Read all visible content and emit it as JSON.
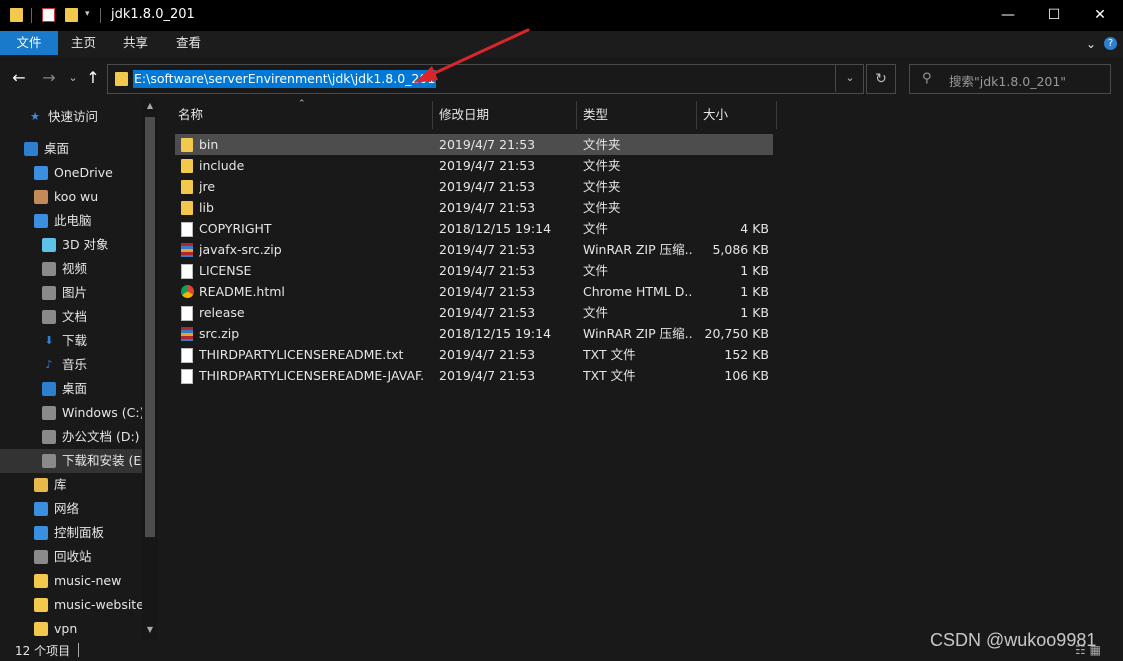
{
  "window": {
    "title": "jdk1.8.0_201",
    "minimize": "—",
    "maximize": "☐",
    "close": "✕"
  },
  "ribbon": {
    "tabs": [
      "文件",
      "主页",
      "共享",
      "查看"
    ],
    "collapse_icon": "chevron-down-icon",
    "help_icon": "question-icon"
  },
  "nav": {
    "back": "←",
    "forward": "→",
    "recent": "⌄",
    "up": "↑",
    "address": "E:\\software\\serverEnvirenment\\jdk\\jdk1.8.0_201",
    "dropdown": "⌄",
    "refresh": "↻",
    "search_placeholder": "搜索\"jdk1.8.0_201\""
  },
  "sidebar": {
    "items": [
      {
        "label": "快速访问",
        "icon": "star-icon",
        "color": "#3b8fe0"
      },
      {
        "label": "桌面",
        "icon": "desktop-icon",
        "color": "#2f7fd1"
      },
      {
        "label": "OneDrive",
        "icon": "cloud-icon",
        "color": "#3b8fe0"
      },
      {
        "label": "koo wu",
        "icon": "user-icon",
        "color": "#c48a5a"
      },
      {
        "label": "此电脑",
        "icon": "computer-icon",
        "color": "#3b8fe0"
      },
      {
        "label": "3D 对象",
        "icon": "cube-icon",
        "color": "#5cc2e8"
      },
      {
        "label": "视频",
        "icon": "video-icon",
        "color": "#8a8a8a"
      },
      {
        "label": "图片",
        "icon": "picture-icon",
        "color": "#8a8a8a"
      },
      {
        "label": "文档",
        "icon": "document-icon",
        "color": "#8a8a8a"
      },
      {
        "label": "下载",
        "icon": "download-icon",
        "color": "#2f7fd1"
      },
      {
        "label": "音乐",
        "icon": "music-icon",
        "color": "#2f7fd1"
      },
      {
        "label": "桌面",
        "icon": "desktop-icon",
        "color": "#2f7fd1"
      },
      {
        "label": "Windows (C:)",
        "icon": "drive-icon",
        "color": "#8a8a8a"
      },
      {
        "label": "办公文档 (D:)",
        "icon": "drive-icon",
        "color": "#8a8a8a"
      },
      {
        "label": "下载和安装 (E:",
        "icon": "drive-icon",
        "color": "#8a8a8a"
      },
      {
        "label": "库",
        "icon": "library-icon",
        "color": "#e8b84a"
      },
      {
        "label": "网络",
        "icon": "network-icon",
        "color": "#3b8fe0"
      },
      {
        "label": "控制面板",
        "icon": "control-panel-icon",
        "color": "#3b8fe0"
      },
      {
        "label": "回收站",
        "icon": "recycle-bin-icon",
        "color": "#8a8a8a"
      },
      {
        "label": "music-new",
        "icon": "folder-icon",
        "color": "#f2c94c"
      },
      {
        "label": "music-website-",
        "icon": "folder-icon",
        "color": "#f2c94c"
      },
      {
        "label": "vpn",
        "icon": "folder-icon",
        "color": "#f2c94c"
      }
    ],
    "selected_index": 14
  },
  "columns": {
    "name": "名称",
    "date": "修改日期",
    "type": "类型",
    "size": "大小"
  },
  "files": [
    {
      "name": "bin",
      "date": "2019/4/7 21:53",
      "type": "文件夹",
      "size": "",
      "icon": "folder"
    },
    {
      "name": "include",
      "date": "2019/4/7 21:53",
      "type": "文件夹",
      "size": "",
      "icon": "folder"
    },
    {
      "name": "jre",
      "date": "2019/4/7 21:53",
      "type": "文件夹",
      "size": "",
      "icon": "folder"
    },
    {
      "name": "lib",
      "date": "2019/4/7 21:53",
      "type": "文件夹",
      "size": "",
      "icon": "folder"
    },
    {
      "name": "COPYRIGHT",
      "date": "2018/12/15 19:14",
      "type": "文件",
      "size": "4 KB",
      "icon": "file"
    },
    {
      "name": "javafx-src.zip",
      "date": "2019/4/7 21:53",
      "type": "WinRAR ZIP 压缩...",
      "size": "5,086 KB",
      "icon": "zip"
    },
    {
      "name": "LICENSE",
      "date": "2019/4/7 21:53",
      "type": "文件",
      "size": "1 KB",
      "icon": "file"
    },
    {
      "name": "README.html",
      "date": "2019/4/7 21:53",
      "type": "Chrome HTML D...",
      "size": "1 KB",
      "icon": "html"
    },
    {
      "name": "release",
      "date": "2019/4/7 21:53",
      "type": "文件",
      "size": "1 KB",
      "icon": "file"
    },
    {
      "name": "src.zip",
      "date": "2018/12/15 19:14",
      "type": "WinRAR ZIP 压缩...",
      "size": "20,750 KB",
      "icon": "zip"
    },
    {
      "name": "THIRDPARTYLICENSEREADME.txt",
      "date": "2019/4/7 21:53",
      "type": "TXT 文件",
      "size": "152 KB",
      "icon": "txt"
    },
    {
      "name": "THIRDPARTYLICENSEREADME-JAVAF...",
      "date": "2019/4/7 21:53",
      "type": "TXT 文件",
      "size": "106 KB",
      "icon": "txt"
    }
  ],
  "selected_file_index": 0,
  "status": {
    "count": "12 个项目",
    "sep": "|"
  },
  "watermark": "CSDN @wukoo9981",
  "colors": {
    "accent": "#0078d7",
    "file_tab": "#1979ca",
    "annotation_arrow": "#d9262b",
    "folder": "#f2c94c"
  }
}
